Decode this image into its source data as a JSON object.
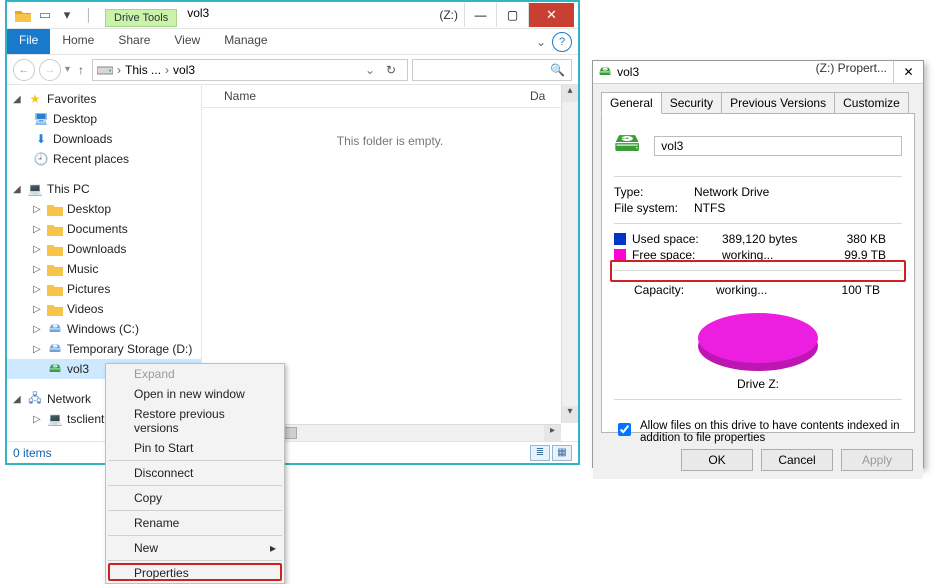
{
  "explorer": {
    "title_tool_label": "Drive Tools",
    "title_volume": "vol3",
    "title_drive": "(Z:)",
    "ribbon": {
      "file": "File",
      "home": "Home",
      "share": "Share",
      "view": "View",
      "manage": "Manage"
    },
    "crumb_root": "This ...",
    "crumb_leaf": "vol3",
    "search_placeholder": "",
    "content_header_name": "Name",
    "content_header_da": "Da",
    "content_empty": "This folder is empty.",
    "sidebar": {
      "fav_label": "Favorites",
      "fav_items": [
        "Desktop",
        "Downloads",
        "Recent places"
      ],
      "pc_label": "This PC",
      "pc_items": [
        "Desktop",
        "Documents",
        "Downloads",
        "Music",
        "Pictures",
        "Videos",
        "Windows (C:)",
        "Temporary Storage (D:)",
        "vol3"
      ],
      "net_label": "Network",
      "net_items": [
        "tsclient"
      ]
    },
    "status_items": "0 items"
  },
  "hscroll_marker": "III",
  "context_menu": {
    "items": [
      {
        "label": "Expand",
        "disabled": true
      },
      {
        "label": "Open in new window"
      },
      {
        "label": "Restore previous versions"
      },
      {
        "label": "Pin to Start"
      },
      {
        "sep": true
      },
      {
        "label": "Disconnect"
      },
      {
        "sep": true
      },
      {
        "label": "Copy"
      },
      {
        "sep": true
      },
      {
        "label": "Rename"
      },
      {
        "sep": true
      },
      {
        "label": "New",
        "sub": true
      },
      {
        "sep": true
      },
      {
        "label": "Properties"
      }
    ]
  },
  "props": {
    "title_vol": "vol3",
    "title_right": "(Z:) Propert...",
    "tabs": {
      "general": "General",
      "security": "Security",
      "prev": "Previous Versions",
      "custom": "Customize"
    },
    "vol_name": "vol3",
    "type_k": "Type:",
    "type_v": "Network Drive",
    "fs_k": "File system:",
    "fs_v": "NTFS",
    "used_label": "Used space:",
    "used_bytes": "389,120 bytes",
    "used_human": "380 KB",
    "free_label": "Free space:",
    "free_bytes": "working...",
    "free_human": "99.9 TB",
    "cap_label": "Capacity:",
    "cap_bytes": "working...",
    "cap_human": "100 TB",
    "drive_caption": "Drive Z:",
    "index_label": "Allow files on this drive to have contents indexed in addition to file properties",
    "btn_ok": "OK",
    "btn_cancel": "Cancel",
    "btn_apply": "Apply"
  }
}
